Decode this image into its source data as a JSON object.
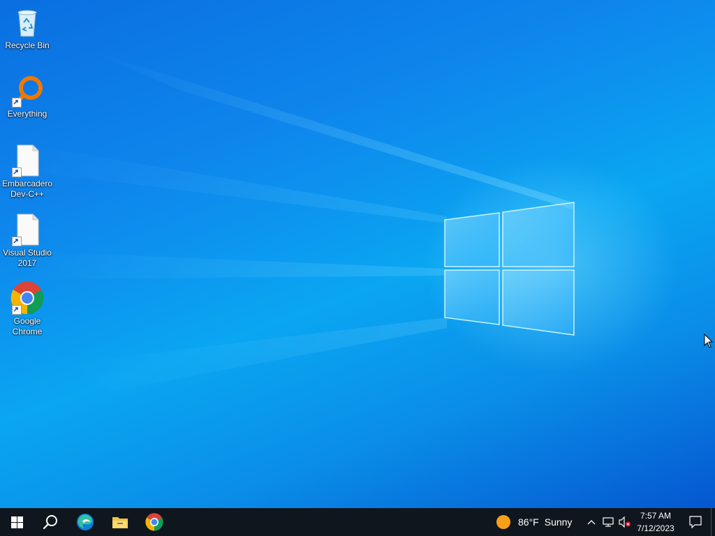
{
  "desktop": {
    "icons": [
      {
        "label": "Recycle Bin",
        "icon": "recycle-bin-icon"
      },
      {
        "label": "Everything",
        "icon": "everything-search-icon",
        "shortcut": true
      },
      {
        "label": "Embarcadero Dev-C++",
        "icon": "blank-file-icon",
        "shortcut": true
      },
      {
        "label": "Visual Studio 2017",
        "icon": "blank-file-icon",
        "shortcut": true
      },
      {
        "label": "Google Chrome",
        "icon": "chrome-icon",
        "shortcut": true
      }
    ]
  },
  "taskbar": {
    "pinned": [
      {
        "name": "start-button",
        "icon": "windows-start-icon"
      },
      {
        "name": "search-button",
        "icon": "search-icon"
      },
      {
        "name": "edge-button",
        "icon": "edge-icon"
      },
      {
        "name": "file-explorer-button",
        "icon": "folder-icon"
      },
      {
        "name": "chrome-button",
        "icon": "chrome-icon"
      }
    ],
    "weather": {
      "temp": "86°F",
      "condition": "Sunny",
      "icon": "sun-icon"
    },
    "tray": {
      "icons": [
        "chevron-up-icon",
        "network-icon",
        "volume-muted-icon"
      ],
      "time": "7:57 AM",
      "date": "7/12/2023",
      "notification_icon": "action-center-icon"
    }
  },
  "colors": {
    "taskbar_bg": "#10161d",
    "desktop_accent": "#0a8ee8",
    "sun": "#f6a019"
  }
}
